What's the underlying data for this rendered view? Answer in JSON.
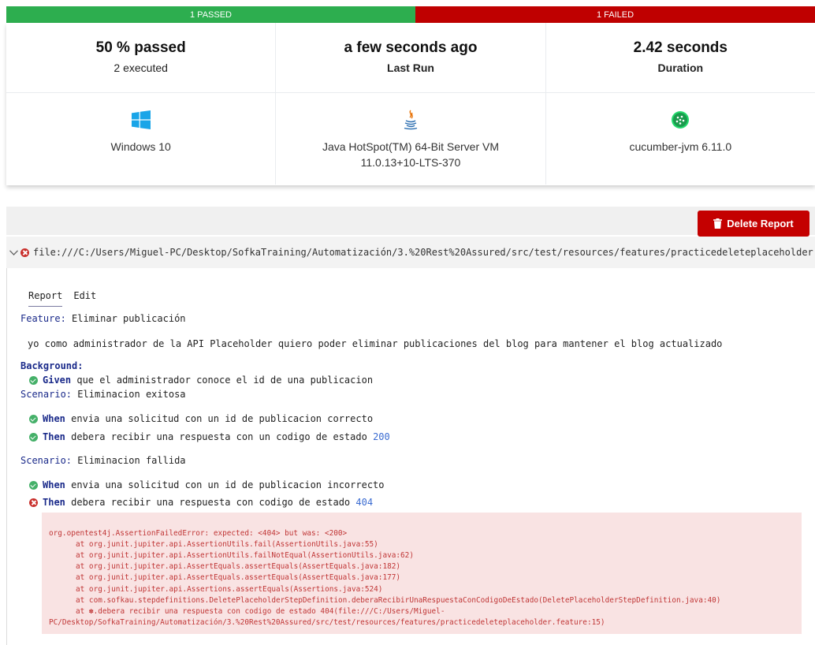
{
  "status_bar": {
    "passed_label": "1 PASSED",
    "failed_label": "1 FAILED",
    "passed_color": "#2dae4f",
    "failed_color": "#bf0000"
  },
  "summary": {
    "pass_rate": "50 % passed",
    "executed": "2 executed",
    "last_run_value": "a few seconds ago",
    "last_run_label": "Last Run",
    "duration_value": "2.42 seconds",
    "duration_label": "Duration"
  },
  "environment": {
    "os": "Windows 10",
    "os_icon": "windows-icon",
    "jvm_line1": "Java HotSpot(TM) 64-Bit Server VM",
    "jvm_line2": "11.0.13+10-LTS-370",
    "jvm_icon": "java-icon",
    "tool": "cucumber-jvm 6.11.0",
    "tool_icon": "cucumber-icon"
  },
  "delete_button": {
    "label": "Delete Report",
    "icon": "trash-icon",
    "color": "#c40000"
  },
  "feature": {
    "uri": "file:///C:/Users/Miguel-PC/Desktop/SofkaTraining/Automatización/3.%20Rest%20Assured/src/test/resources/features/practicedeleteplaceholder.feature",
    "tabs": [
      "Report",
      "Edit"
    ],
    "keyword": "Feature:",
    "name": "Eliminar publicación",
    "description": "yo como administrador de la API Placeholder quiero poder eliminar publicaciones del blog para mantener el blog actualizado",
    "background_keyword": "Background:",
    "background_step": {
      "status": "passed",
      "keyword": "Given",
      "text": "que el administrador conoce el id de una publicacion"
    },
    "scenario1": {
      "keyword": "Scenario:",
      "name": "Eliminacion exitosa",
      "step1": {
        "status": "passed",
        "keyword": "When",
        "text": "envia una solicitud con un id de publicacion correcto"
      },
      "step2": {
        "status": "passed",
        "keyword": "Then",
        "text": "debera recibir una respuesta con un codigo de estado",
        "arg": "200"
      }
    },
    "scenario2": {
      "keyword": "Scenario:",
      "name": "Eliminacion fallida",
      "step1": {
        "status": "passed",
        "keyword": "When",
        "text": "envia una solicitud con un id de publicacion incorrecto"
      },
      "step2": {
        "status": "failed",
        "keyword": "Then",
        "text": "debera recibir una respuesta con codigo de estado",
        "arg": "404"
      }
    },
    "error_lines": [
      "org.opentest4j.AssertionFailedError: expected: <404> but was: <200>",
      "\tat org.junit.jupiter.api.AssertionUtils.fail(AssertionUtils.java:55)",
      "\tat org.junit.jupiter.api.AssertionUtils.failNotEqual(AssertionUtils.java:62)",
      "\tat org.junit.jupiter.api.AssertEquals.assertEquals(AssertEquals.java:182)",
      "\tat org.junit.jupiter.api.AssertEquals.assertEquals(AssertEquals.java:177)",
      "\tat org.junit.jupiter.api.Assertions.assertEquals(Assertions.java:524)",
      "\tat com.sofkau.stepdefinitions.DeletePlaceholderStepDefinition.deberaRecibirUnaRespuestaConCodigoDeEstado(DeletePlaceholderStepDefinition.java:40)",
      "\tat ✽.debera recibir una respuesta con codigo de estado 404(file:///C:/Users/Miguel-",
      "PC/Desktop/SofkaTraining/Automatización/3.%20Rest%20Assured/src/test/resources/features/practicedeleteplaceholder.feature:15)"
    ]
  }
}
